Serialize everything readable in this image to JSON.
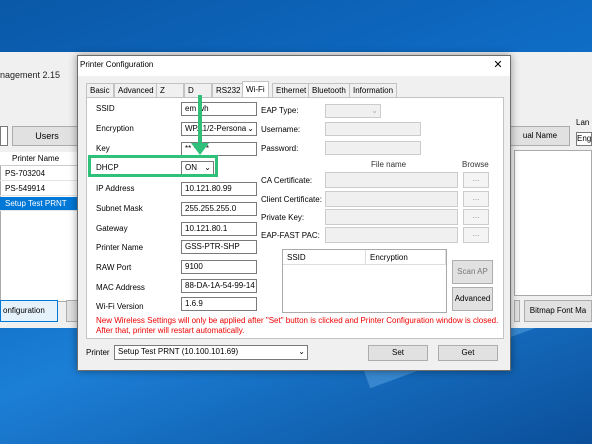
{
  "background_app": {
    "title_fragment": "nagement 2.15",
    "users_button": "Users",
    "list_header": "Printer Name",
    "printers": [
      "PS-703204",
      "PS-549914",
      "Setup Test PRNT"
    ],
    "config_button": "onfiguration",
    "dual_name_button": "ual Name",
    "language_label": "Lan",
    "language_value": "Engl",
    "bitmap_button": "Bitmap Font Ma"
  },
  "dialog": {
    "title": "Printer Configuration",
    "close_icon": "close-icon",
    "tabs": [
      "Basic",
      "Advanced",
      "Z",
      "D",
      "RS232",
      "Wi-Fi",
      "Ethernet",
      "Bluetooth",
      "Information"
    ],
    "active_tab": "Wi-Fi",
    "left_fields": {
      "ssid": {
        "label": "SSID",
        "value": "em   wh"
      },
      "encryption": {
        "label": "Encryption",
        "value": "WPA1/2-Persona"
      },
      "key": {
        "label": "Key",
        "value": "**     *****"
      },
      "dhcp": {
        "label": "DHCP",
        "value": "ON"
      },
      "ip": {
        "label": "IP Address",
        "value": "10.121.80.99"
      },
      "subnet": {
        "label": "Subnet Mask",
        "value": "255.255.255.0"
      },
      "gateway": {
        "label": "Gateway",
        "value": "10.121.80.1"
      },
      "printer_name": {
        "label": "Printer Name",
        "value": "GSS-PTR-SHP"
      },
      "raw_port": {
        "label": "RAW Port",
        "value": "9100"
      },
      "mac": {
        "label": "MAC Address",
        "value": "88-DA-1A-54-99-14"
      },
      "wifi_version": {
        "label": "Wi-Fi Version",
        "value": "1.6.9"
      }
    },
    "right_fields": {
      "eap_type": "EAP Type:",
      "username": "Username:",
      "password": "Password:",
      "file_name_header": "File name",
      "browse_header": "Browse",
      "ca_cert": "CA Certificate:",
      "client_cert": "Client Certificate:",
      "private_key": "Private Key:",
      "eap_fast_pac": "EAP-FAST PAC:",
      "browse_label": "..."
    },
    "ap_table": {
      "columns": [
        "SSID",
        "Encryption"
      ]
    },
    "scan_ap_button": "Scan AP",
    "advanced_button": "Advanced",
    "note": "New Wireless Settings will only be applied after \"Set\" button is clicked and Printer Configuration window is closed. After that, printer will restart automatically.",
    "printer_label": "Printer",
    "printer_value": "Setup Test PRNT (10.100.101.69)",
    "set_button": "Set",
    "get_button": "Get"
  },
  "annotation": {
    "color": "#2fc17a"
  }
}
